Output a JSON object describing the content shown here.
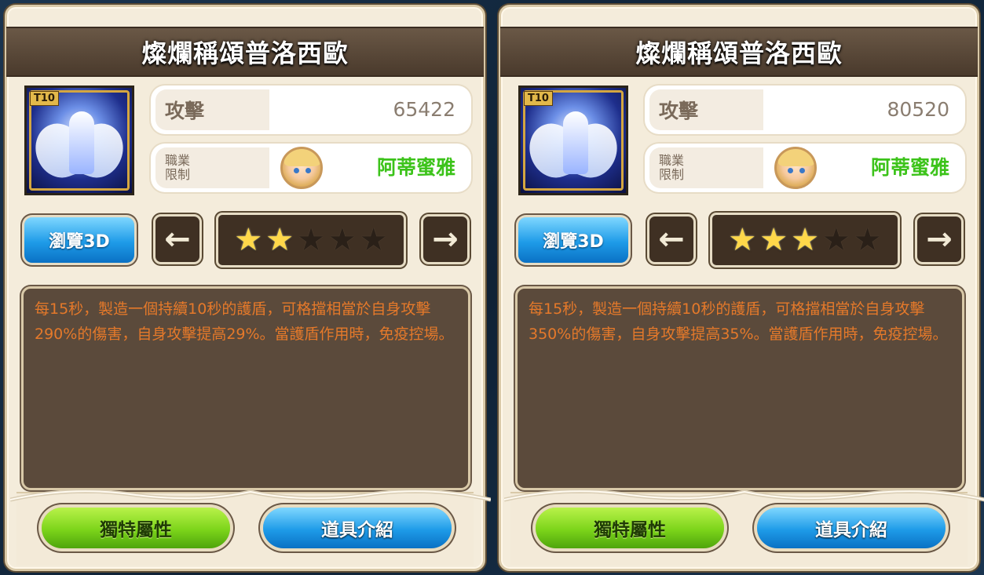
{
  "panels": [
    {
      "title": "燦爛稱頌普洛西歐",
      "tier_badge": "T10",
      "attack_label": "攻擊",
      "attack_value": "65422",
      "job_label": "職業\n限制",
      "job_value": "阿蒂蜜雅",
      "view3d_label": "瀏覽3D",
      "prev_icon": "←",
      "next_icon": "→",
      "stars_filled": 2,
      "stars_total": 5,
      "description": "每15秒，製造一個持續10秒的護盾，可格擋相當於自身攻擊290%的傷害，自身攻擊提高29%。當護盾作用時，免疫控場。",
      "unique_attr_label": "獨特屬性",
      "item_intro_label": "道具介紹"
    },
    {
      "title": "燦爛稱頌普洛西歐",
      "tier_badge": "T10",
      "attack_label": "攻擊",
      "attack_value": "80520",
      "job_label": "職業\n限制",
      "job_value": "阿蒂蜜雅",
      "view3d_label": "瀏覽3D",
      "prev_icon": "←",
      "next_icon": "→",
      "stars_filled": 3,
      "stars_total": 5,
      "description": "每15秒，製造一個持續10秒的護盾，可格擋相當於自身攻擊350%的傷害，自身攻擊提高35%。當護盾作用時，免疫控場。",
      "unique_attr_label": "獨特屬性",
      "item_intro_label": "道具介紹"
    }
  ],
  "colors": {
    "job_value": "#3cc31a",
    "description_text": "#e5792a",
    "star_on": "#ffd84a",
    "button_blue": "#1e9be8",
    "button_green": "#7cd41a"
  }
}
